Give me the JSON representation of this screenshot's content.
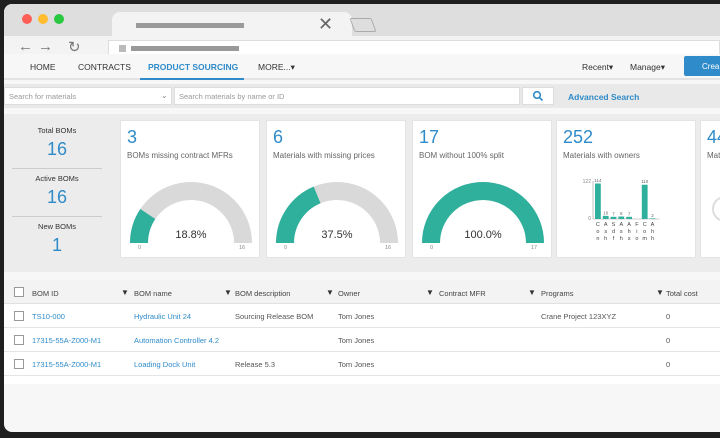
{
  "browser": {
    "colors": {
      "close": "#ff5f57",
      "min": "#febc2e",
      "max": "#28c840"
    },
    "nav_icons": [
      "←",
      "→",
      "↻"
    ]
  },
  "nav": {
    "items": [
      "HOME",
      "CONTRACTS",
      "PRODUCT SOURCING",
      "MORE...▾"
    ],
    "right": [
      "Recent▾",
      "Manage▾"
    ],
    "create": "Crea"
  },
  "search": {
    "placeholder1": "Search for materials",
    "placeholder2": "Search materials by name or ID",
    "advanced": "Advanced Search"
  },
  "stats": [
    {
      "label": "Total BOMs",
      "value": "16"
    },
    {
      "label": "Active BOMs",
      "value": "16"
    },
    {
      "label": "New BOMs",
      "value": "1"
    }
  ],
  "gauges": [
    {
      "big": "3",
      "desc": "BOMs missing contract MFRs",
      "pct_text": "18.8%",
      "fill": 0.188,
      "min": "0",
      "max": "16"
    },
    {
      "big": "6",
      "desc": "Materials with missing prices",
      "pct_text": "37.5%",
      "fill": 0.375,
      "min": "0",
      "max": "16"
    },
    {
      "big": "17",
      "desc": "BOM without 100% split",
      "pct_text": "100.0%",
      "fill": 1.0,
      "min": "0",
      "max": "17"
    }
  ],
  "owners_card": {
    "big": "252",
    "desc": "Materials with owners",
    "ymax": "122",
    "ymin": "0"
  },
  "partial_card": {
    "big": "44",
    "desc": "Mate"
  },
  "chart_data": {
    "type": "bar",
    "title": "Materials with owners",
    "categories": [
      "Con",
      "Ash",
      "Sdf",
      "Ash",
      "Ahs",
      "Fio",
      "Com",
      "Ahh"
    ],
    "values": [
      114,
      10,
      7,
      8,
      7,
      0,
      110,
      2
    ],
    "value_labels": [
      "114",
      "10",
      "7",
      "8",
      "7",
      "",
      "110",
      "2"
    ],
    "ylim": [
      0,
      122
    ],
    "color": "#2fb09c"
  },
  "table": {
    "headers": [
      "BOM ID",
      "BOM name",
      "BOM description",
      "Owner",
      "Contract MFR",
      "Programs",
      "Total cost"
    ],
    "rows": [
      [
        "TS10-000",
        "Hydraulic Unit 24",
        "Sourcing Release BOM",
        "Tom Jones",
        "",
        "Crane Project 123XYZ",
        "0"
      ],
      [
        "17315-55A-Z000-M1",
        "Automation Controller 4.2",
        "",
        "Tom Jones",
        "",
        "",
        "0"
      ],
      [
        "17315-55A-Z000-M1",
        "Loading Dock Unit",
        "Release 5.3",
        "Tom Jones",
        "",
        "",
        "0"
      ]
    ]
  },
  "accent": "#2f8bc9",
  "teal": "#2fb09c"
}
